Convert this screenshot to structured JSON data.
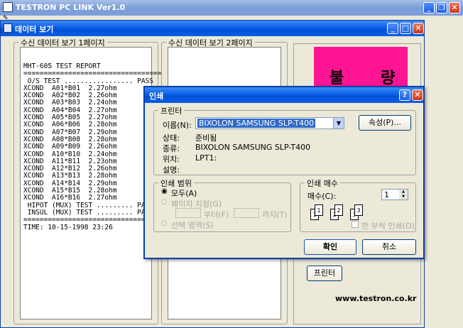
{
  "app": {
    "title": "TESTRON PC LINK Ver1.0",
    "menu_icon_glyph": "✎"
  },
  "viewer": {
    "title": "데이터 보기"
  },
  "page1": {
    "label": "수신 데이터 보기 1페이지",
    "lines": [
      "MHT-605 TEST REPORT",
      "==================================",
      " O/S TEST ................. PASS",
      "XCOND  A01*B01  2.27ohm",
      "XCOND  A02*B02  2.26ohm",
      "XCOND  A03*B03  2.24ohm",
      "XCOND  A04*B04  2.27ohm",
      "XCOND  A05*B05  2.27ohm",
      "XCOND  A06*B06  2.28ohm",
      "XCOND  A07*B07  2.29ohm",
      "XCOND  A08*B08  2.28ohm",
      "XCOND  A09*B09  2.26ohm",
      "XCOND  A10*B10  2.24ohm",
      "XCOND  A11*B11  2.23ohm",
      "XCOND  A12*B12  2.26ohm",
      "XCOND  A13*B13  2.28ohm",
      "XCOND  A14*B14  2.29ohm",
      "XCOND  A15*B15  2.28ohm",
      "XCOND  A16*B16  2.27ohm",
      " HIPOT (MUX) TEST ......... PASS",
      " INSUL (MUX) TEST ......... PASS",
      "==================================",
      "TIME: 10-15-1998 23:26"
    ]
  },
  "page2": {
    "label": "수신 데이터 보기 2페이지"
  },
  "result_badge": {
    "char1": "불",
    "char2": "량",
    "color": "#ff1493"
  },
  "print_button": "프린터",
  "website": "www.testron.co.kr",
  "dialog": {
    "title": "인쇄",
    "printer_group": "프린터",
    "name_label": "이름(N):",
    "name_value": "BIXOLON SAMSUNG SLP-T400",
    "properties_button": "속성(P)...",
    "status_label": "상태:",
    "status_value": "준비됨",
    "type_label": "종류:",
    "type_value": "BIXOLON SAMSUNG SLP-T400",
    "where_label": "위치:",
    "where_value": "LPT1:",
    "comment_label": "설명:",
    "comment_value": "",
    "range_group": "인쇄 범위",
    "range_all": "모두(A)",
    "range_pages": "페이지 지정(G)",
    "from_label": "부터(F)",
    "to_label": "까지(T)",
    "range_selection": "선택 영역(S)",
    "copies_group": "인쇄 매수",
    "copies_label": "매수(C):",
    "copies_value": "1",
    "collate_label": "한 부씩 인쇄(O)",
    "ok_button": "확인",
    "cancel_button": "취소"
  }
}
